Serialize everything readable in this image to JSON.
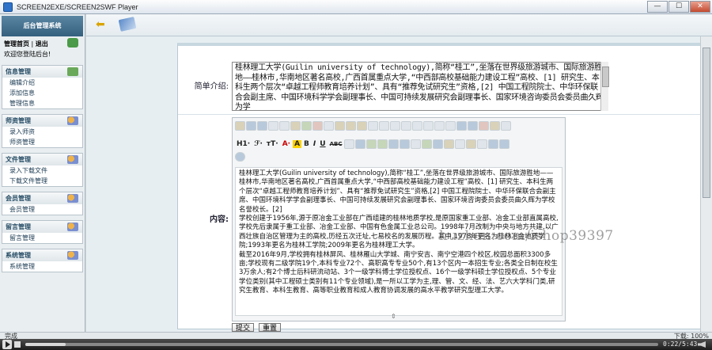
{
  "window": {
    "title": "SCREEN2EXE/SCREEN2SWF Player",
    "min": "—",
    "max": "☐",
    "close": "✕"
  },
  "sidebar": {
    "header": "后台管理系统",
    "nav_home": "管理首页",
    "nav_sep": "|",
    "nav_logout": "退出",
    "welcome": "欢迎您登陆后台!",
    "groups": [
      {
        "title": "信息管理",
        "items": [
          "编辑介绍",
          "添加信息",
          "管理信息"
        ]
      },
      {
        "title": "师资管理",
        "items": [
          "录入师资",
          "师资管理"
        ]
      },
      {
        "title": "文件管理",
        "items": [
          "录入下载文件",
          "下载文件管理"
        ]
      },
      {
        "title": "会员管理",
        "items": [
          "会员管理"
        ]
      },
      {
        "title": "留言管理",
        "items": [
          "留言管理"
        ]
      },
      {
        "title": "系统管理",
        "items": [
          "系统管理"
        ]
      }
    ]
  },
  "form": {
    "intro_label": "简单介绍:",
    "intro_value": "桂林理工大学(Guilin university of technology),简称“桂工”,坐落在世界级旅游城市、国际旅游胜地——桂林市,华南地区著名高校,广西首属重点大学,“中西部高校基础能力建设工程”高校、[1] 研究生、本科生两个层次“卓越工程师教育培养计划”、具有“推荐免试研究生”资格,[2] 中国工程院院士、中华环保联合会副主席、中国环境科学学会副理事长、中国可持续发展研究会副理事长、国家环境咨询委员会委员曲久辉为学",
    "content_label": "内容:",
    "editor_toolbar_text": {
      "h1": "H1·",
      "font": "ℱ·",
      "size": "тT·",
      "color": "A·",
      "bg": "A",
      "bold": "B",
      "italic": "I",
      "underline": "U",
      "strike": "ABC"
    },
    "content_paragraphs": [
      "桂林理工大学(Guilin university of technology),简称“桂工”,坐落在世界级旅游城市、国际旅游胜地——桂林市,华南地区著名高校,广西首属重点大学,“中西部高校基础能力建设工程”高校、[1] 研究生、本科生两个层次“卓越工程师教育培养计划”、具有“推荐免试研究生”资格,[2] 中国工程院院士、中华环保联合会副主席、中国环境科学学会副理事长、中国可持续发展研究会副理事长、国家环境咨询委员会委员曲久辉为学校名誉校长。[2]",
      "学校创建于1956年,源于原冶金工业部在广西组建的桂林地质学校,是原国家重工业部、冶金工业部直属高校,学校先后隶属于重工业部、冶金工业部、中国有色金属工业总公司。1998年7月改制为中央与地方共建,以广西壮族自治区管理为主的高校,历经五次迁址,七易校名的发展历程。其中,1978年更名为桂林冶金地质学院;1993年更名为桂林工学院;2009年更名为桂林理工大学。",
      "截至2016年9月,学校拥有桂林屏风、桂林雁山大学城、南宁安吉、南宁空港四个校区,校园总面积3300多亩;学校现有二级学院19个,本科专业72个、高职高专专业50个,有13个区内一本招生专业;各类全日制在校生3万余人;有2个博士后科研流动站、3个一级学科博士学位授权点、16个一级学科硕士学位授权点、5个专业学位类别(其中工程硕士类别有11个专业领域),是一所以工学为主,理、管、文、经、法、艺六大学科门类,研究生教育、本科生教育、高等职业教育和成人教育协调发展的高水平教学研究型理工大学。"
    ],
    "submit_label": "提交",
    "reset_label": "重置"
  },
  "watermark": "huzhan.com/ishop39397",
  "statusbar": {
    "left": "完成",
    "download": "下载:",
    "zoom": "100%"
  },
  "player": {
    "time": "0:22/5:43",
    "progress": 0.064
  }
}
